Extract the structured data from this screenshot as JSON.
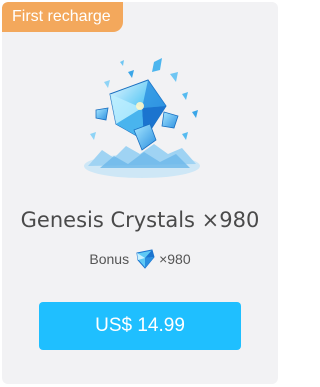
{
  "badge": {
    "label": "First recharge"
  },
  "product": {
    "title": "Genesis Crystals ×980",
    "image_icon": "genesis-crystal-pile-icon"
  },
  "bonus": {
    "label": "Bonus",
    "amount": "×980",
    "icon": "crystal-icon"
  },
  "purchase": {
    "price_label": "US$ 14.99"
  },
  "colors": {
    "badge": "#f3a85c",
    "button": "#1fbfff",
    "card": "#f2f2f4"
  }
}
